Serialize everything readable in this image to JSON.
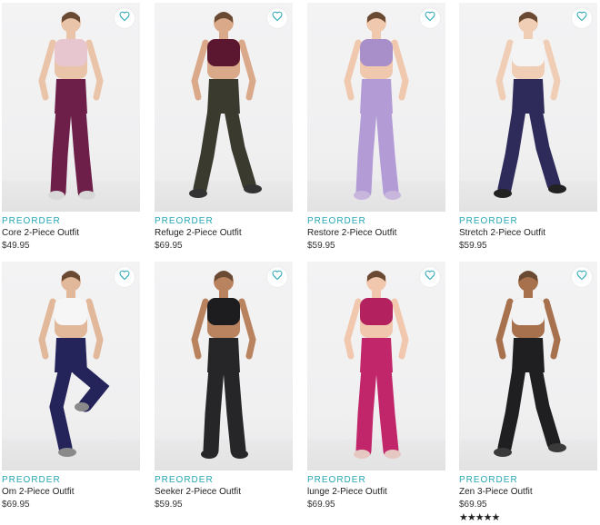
{
  "products": [
    {
      "preorder": "PREORDER",
      "name": "Core 2-Piece Outfit",
      "price": "$49.95",
      "top": "#e8c6cf",
      "bottom": "#6d1f4a",
      "shoe": "#d8d8d8",
      "pose": "back"
    },
    {
      "preorder": "PREORDER",
      "name": "Refuge 2-Piece Outfit",
      "price": "$69.95",
      "top": "#5c1730",
      "bottom": "#3b3a2e",
      "shoe": "#333333",
      "pose": "walk"
    },
    {
      "preorder": "PREORDER",
      "name": "Restore 2-Piece Outfit",
      "price": "$59.95",
      "top": "#a88fc9",
      "bottom": "#b39bd6",
      "shoe": "#c9b6dd",
      "pose": "stand"
    },
    {
      "preorder": "PREORDER",
      "name": "Stretch 2-Piece Outfit",
      "price": "$59.95",
      "top": "#f4f4f4",
      "bottom": "#2e2b5a",
      "shoe": "#222222",
      "pose": "walk"
    },
    {
      "preorder": "PREORDER",
      "name": "Om 2-Piece Outfit",
      "price": "$69.95",
      "top": "#f6f6f6",
      "bottom": "#25245a",
      "shoe": "#8a8a8a",
      "pose": "run"
    },
    {
      "preorder": "PREORDER",
      "name": "Seeker 2-Piece Outfit",
      "price": "$59.95",
      "top": "#1d1d1f",
      "bottom": "#262628",
      "shoe": "#262628",
      "pose": "stand"
    },
    {
      "preorder": "PREORDER",
      "name": "lunge 2-Piece Outfit",
      "price": "$69.95",
      "top": "#b3215f",
      "bottom": "#c2266a",
      "shoe": "#e6c8c2",
      "pose": "stand"
    },
    {
      "preorder": "PREORDER",
      "name": "Zen 3-Piece Outfit",
      "price": "$69.95",
      "top": "#f3f3f3",
      "bottom": "#1f1f22",
      "shoe": "#3a3a3a",
      "pose": "walk",
      "rating_stars": "★★★★★"
    }
  ],
  "icons": {
    "favorite": "heart-outline-icon"
  },
  "colors": {
    "accent": "#28a6b2"
  }
}
